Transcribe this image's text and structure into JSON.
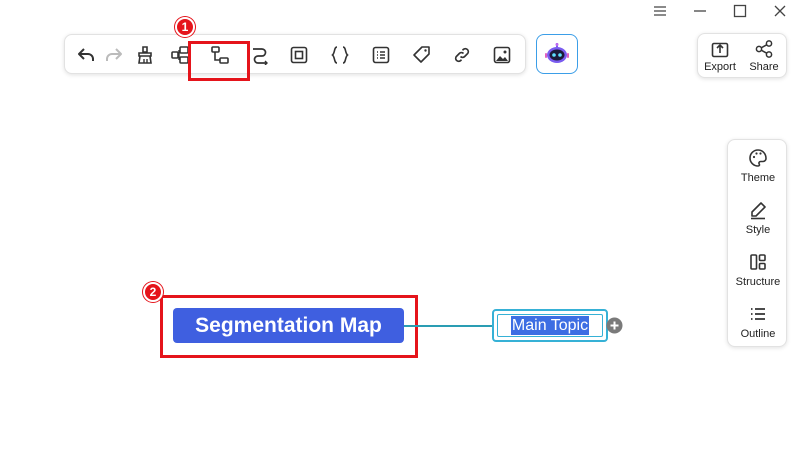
{
  "toolbar": {
    "icons": [
      "undo-icon",
      "redo-icon",
      "format-painter-icon",
      "insert-subtopic-icon",
      "insert-layout-icon",
      "relationship-icon",
      "boundary-icon",
      "summary-icon",
      "notes-icon",
      "tag-icon",
      "link-icon",
      "image-icon"
    ]
  },
  "ai_assistant": {
    "icon": "robot-icon"
  },
  "top_panel": {
    "export_label": "Export",
    "share_label": "Share"
  },
  "side_panel": {
    "items": [
      {
        "label": "Theme",
        "icon": "palette-icon"
      },
      {
        "label": "Style",
        "icon": "pen-icon"
      },
      {
        "label": "Structure",
        "icon": "structure-icon"
      },
      {
        "label": "Outline",
        "icon": "outline-list-icon"
      }
    ]
  },
  "annotations": {
    "badge1": "1",
    "badge2": "2",
    "color": "#e5141b"
  },
  "mindmap": {
    "central_topic": "Segmentation Map",
    "main_topic": "Main Topic",
    "central_color": "#3f5fe0",
    "accent_color": "#36b1d6"
  }
}
